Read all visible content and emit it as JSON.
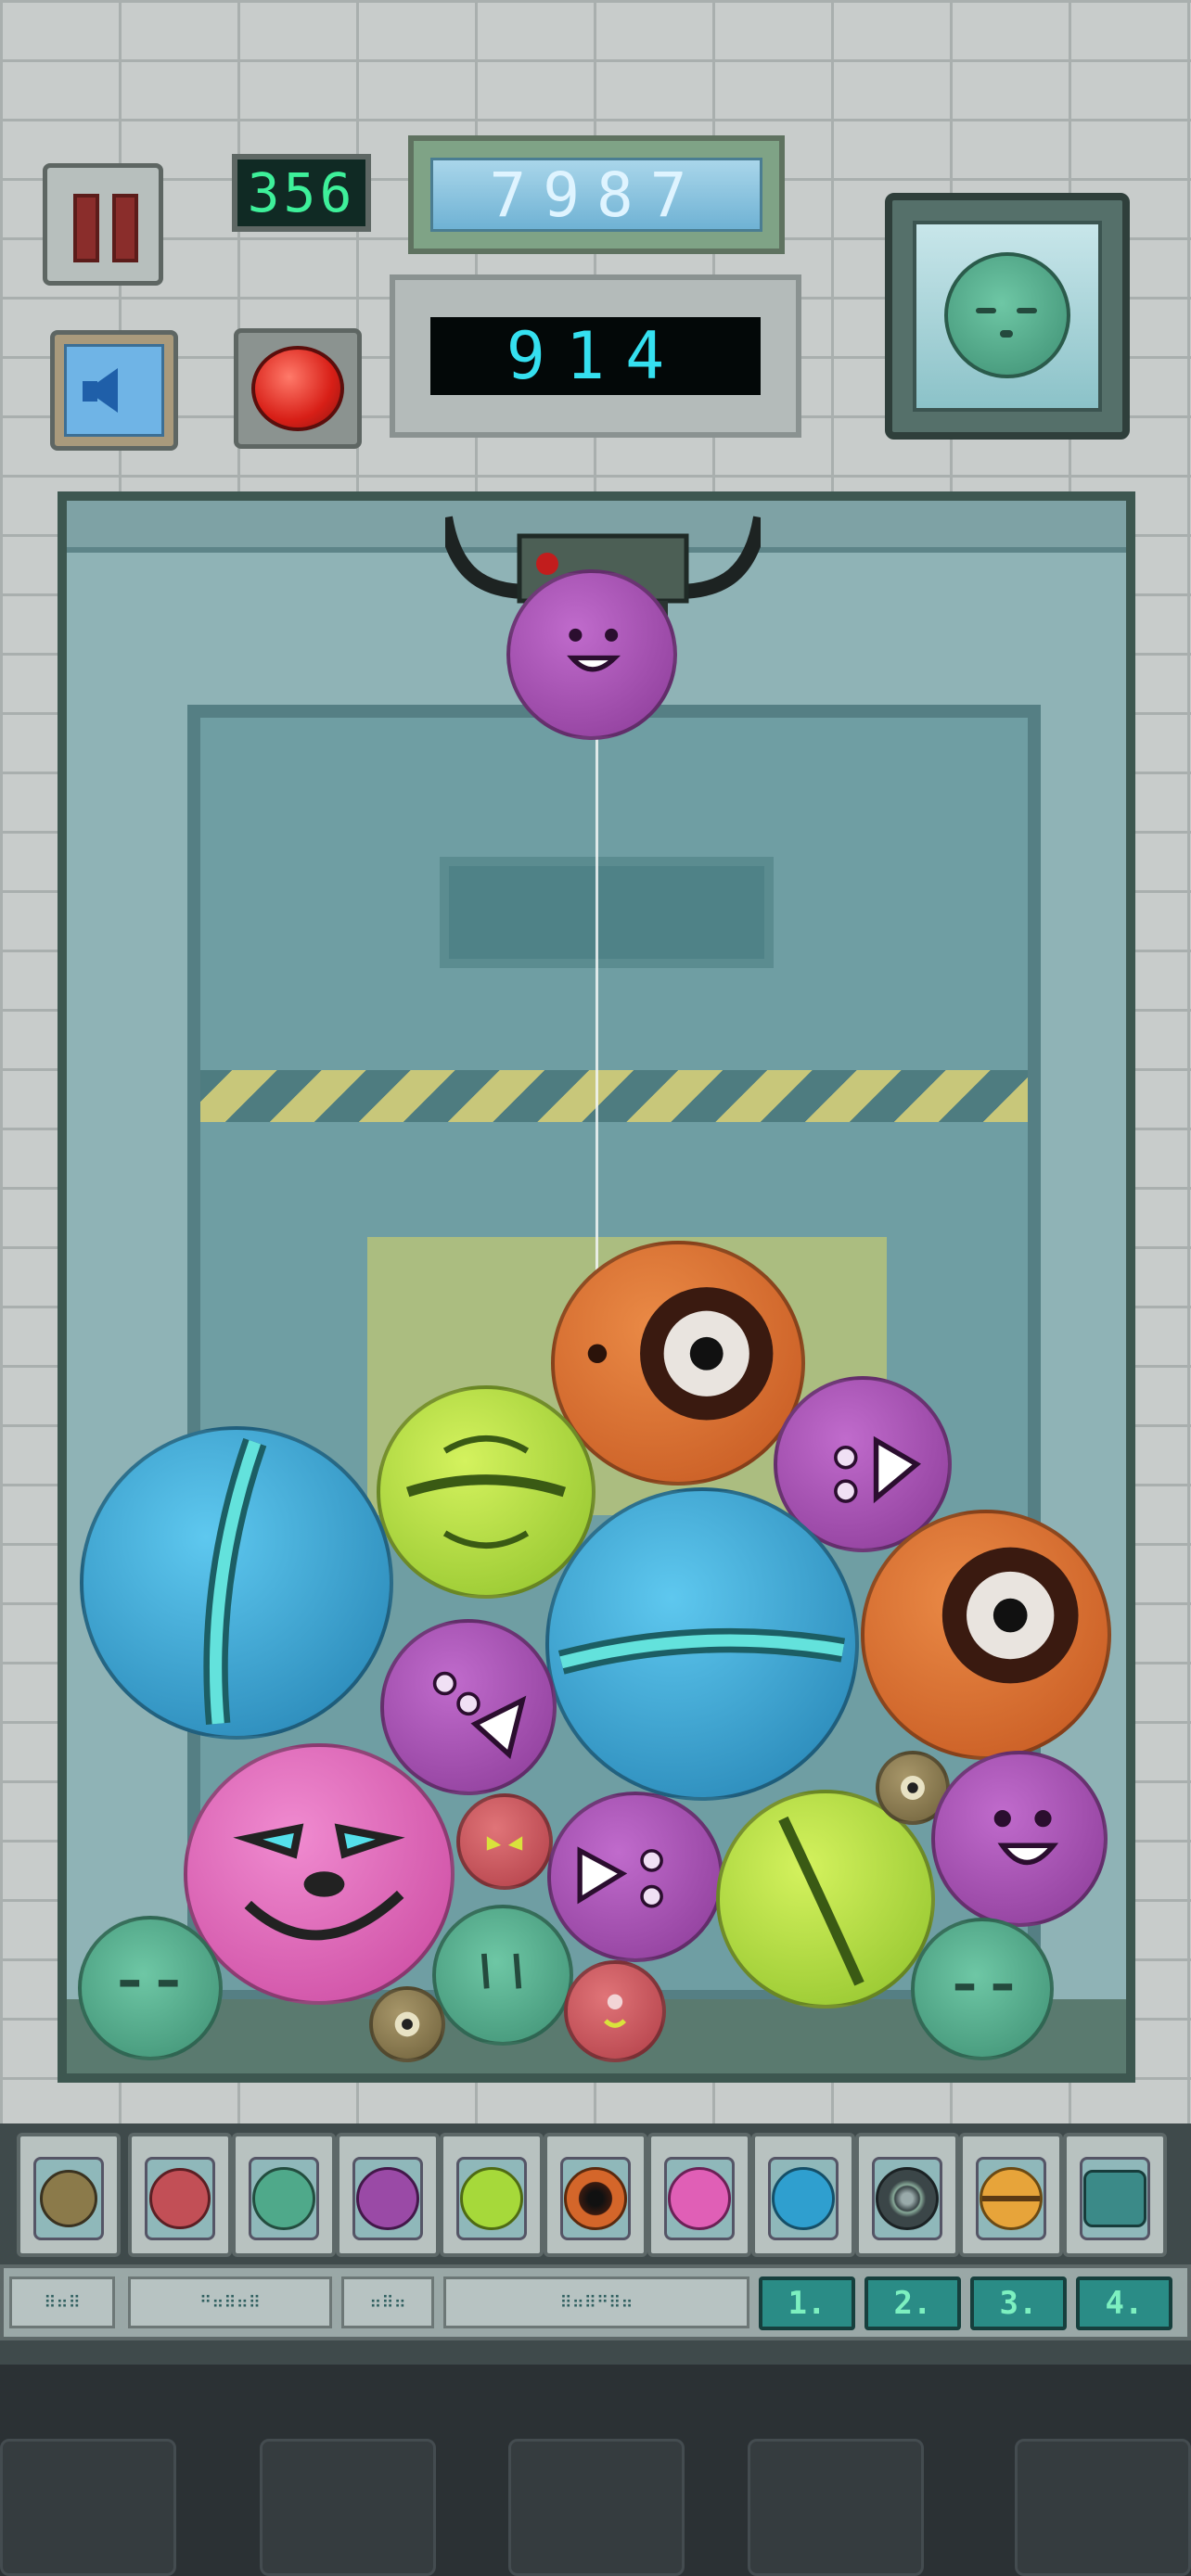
{
  "hud": {
    "moves": "356",
    "high_score": "7987",
    "score": "914",
    "buttons": {
      "pause": "pause",
      "sound": "sound",
      "red": "drop"
    },
    "next_preview": "green-germ"
  },
  "accent_colors": {
    "lcd_green": "#3ef09a",
    "lcd_cyan": "#35e0f0",
    "lcd_blue_bg": "#7fb9d6"
  },
  "current_ball": "purple-germ",
  "balls": [
    {
      "name": "purple-germ-dropping",
      "color": "#9a4aa6"
    },
    {
      "name": "orange-eye-germ",
      "color": "#d4662a"
    },
    {
      "name": "lime-germ",
      "color": "#a6d93a"
    },
    {
      "name": "purple-germ",
      "color": "#9a4aa6"
    },
    {
      "name": "blue-germ",
      "color": "#2f9fcf"
    },
    {
      "name": "blue-germ",
      "color": "#2f9fcf"
    },
    {
      "name": "orange-eye-germ",
      "color": "#d4662a"
    },
    {
      "name": "purple-germ",
      "color": "#9a4aa6"
    },
    {
      "name": "pink-germ",
      "color": "#e05fb6"
    },
    {
      "name": "small-red-germ",
      "color": "#c24f56"
    },
    {
      "name": "purple-germ",
      "color": "#9a4aa6"
    },
    {
      "name": "lime-germ",
      "color": "#a6d93a"
    },
    {
      "name": "small-tan-germ",
      "color": "#8b7a4a"
    },
    {
      "name": "purple-germ",
      "color": "#9a4aa6"
    },
    {
      "name": "green-germ",
      "color": "#4fa98a"
    },
    {
      "name": "green-germ",
      "color": "#4fa98a"
    },
    {
      "name": "small-tan-germ",
      "color": "#8b7a4a"
    },
    {
      "name": "small-red-germ",
      "color": "#c24f56"
    },
    {
      "name": "green-germ",
      "color": "#4fa98a"
    }
  ],
  "evolution": [
    {
      "name": "tan-germ",
      "color": "#8b7a4a"
    },
    {
      "name": "red-germ",
      "color": "#c24f56"
    },
    {
      "name": "green-germ",
      "color": "#4fa98a"
    },
    {
      "name": "purple-germ",
      "color": "#9a4aa6"
    },
    {
      "name": "lime-germ",
      "color": "#a6d93a"
    },
    {
      "name": "orange-eye-germ",
      "color": "#d4662a"
    },
    {
      "name": "pink-germ",
      "color": "#e05fb6"
    },
    {
      "name": "blue-germ",
      "color": "#2f9fcf"
    },
    {
      "name": "dark-ring-germ",
      "color": "#3b4648"
    },
    {
      "name": "orange-stripe-germ",
      "color": "#e7a43a"
    },
    {
      "name": "robot-germ",
      "color": "#3b8a88"
    }
  ],
  "levels": [
    "1.",
    "2.",
    "3.",
    "4."
  ]
}
